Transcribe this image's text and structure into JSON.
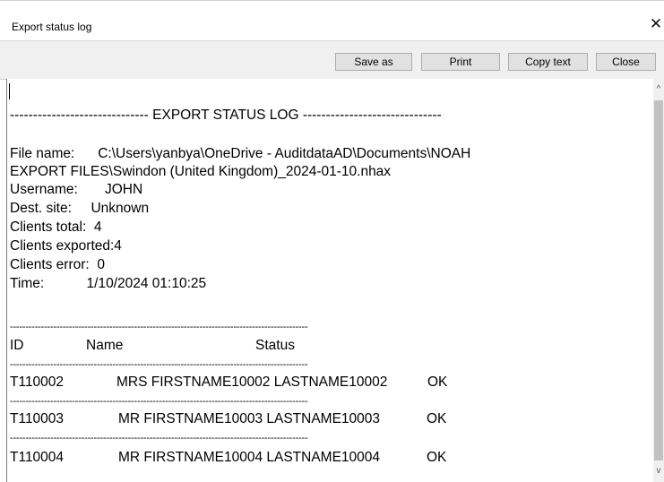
{
  "window": {
    "title": "Export status log",
    "close_glyph": "✕"
  },
  "toolbar": {
    "save_as": "Save as",
    "print": "Print",
    "copy_text": "Copy text",
    "close": "Close"
  },
  "log": {
    "header": "------------------------------ EXPORT STATUS LOG ------------------------------",
    "file_name_line1": "File name:      C:\\Users\\yanbya\\OneDrive - AuditdataAD\\Documents\\NOAH",
    "file_name_line2": "EXPORT FILES\\Swindon (United Kingdom)_2024-01-10.nhax",
    "username": "Username:       JOHN",
    "dest_site": "Dest. site:     Unknown",
    "clients_total": "Clients total:  4",
    "clients_exported": "Clients exported:4",
    "clients_error": "Clients error:  0",
    "time": "Time:           1/10/2024 01:10:25",
    "separator": "------------------------------------------------------------------------------------------------",
    "columns": {
      "id": "ID",
      "name": "Name",
      "status": "Status"
    },
    "rows": [
      {
        "id": "T110002",
        "name": "MRS FIRSTNAME10002 LASTNAME10002",
        "status": "OK"
      },
      {
        "id": "T110003",
        "name": "MR FIRSTNAME10003 LASTNAME10003",
        "status": "OK"
      },
      {
        "id": "T110004",
        "name": "MR FIRSTNAME10004 LASTNAME10004",
        "status": "OK"
      }
    ]
  },
  "scrollbar": {
    "up_glyph": "^",
    "down_glyph": "v"
  }
}
